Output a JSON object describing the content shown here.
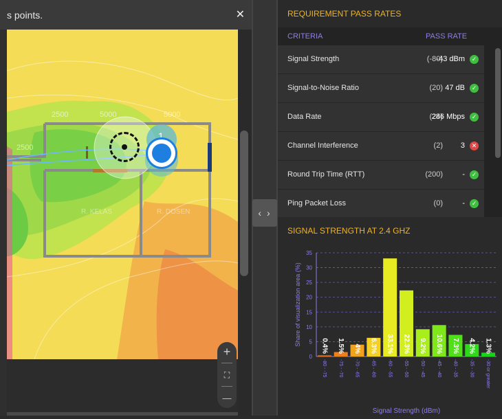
{
  "map": {
    "title": "s points.",
    "room_labels": [
      "R. KELAS",
      "R. DOSEN"
    ],
    "contour_labels": [
      "2500",
      "5000",
      "5000",
      "2500"
    ],
    "ap_badge": "1",
    "zoom_in": "+",
    "zoom_fit": "⛶",
    "zoom_out": "—"
  },
  "divider": {
    "collapse_label": "‹ ›"
  },
  "requirements": {
    "title": "REQUIREMENT PASS RATES",
    "col_criteria": "CRITERIA",
    "col_pass": "PASS RATE",
    "rows": [
      {
        "label": "Signal Strength",
        "threshold": "(-80)",
        "value": "-43 dBm",
        "status": "pass"
      },
      {
        "label": "Signal-to-Noise Ratio",
        "threshold": "(20)",
        "value": "47 dB",
        "status": "pass"
      },
      {
        "label": "Data Rate",
        "threshold": "(24)",
        "value": "286 Mbps",
        "status": "pass"
      },
      {
        "label": "Channel Interference",
        "threshold": "(2)",
        "value": "3",
        "status": "fail"
      },
      {
        "label": "Round Trip Time (RTT)",
        "threshold": "(200)",
        "value": "-",
        "status": "pass"
      },
      {
        "label": "Ping Packet Loss",
        "threshold": "(0)",
        "value": "-",
        "status": "pass"
      }
    ]
  },
  "chart_data": {
    "type": "bar",
    "title": "SIGNAL STRENGTH AT 2.4 GHZ",
    "xlabel": "Signal Strength (dBm)",
    "ylabel": "Share of visualization area (%)",
    "ylim": [
      0,
      35
    ],
    "yticks": [
      0,
      5,
      10,
      15,
      20,
      25,
      30,
      35
    ],
    "categories": [
      "-80 - -75",
      "-75 - -70",
      "-70 - -65",
      "-65 - -60",
      "-60 - -55",
      "-55 - -50",
      "-50 - -45",
      "-45 - -40",
      "-40 - -35",
      "-35 - -30",
      "-30 or greater"
    ],
    "values": [
      0.4,
      1.5,
      4,
      6.3,
      33.1,
      22.3,
      9.2,
      10.6,
      7.3,
      4.2,
      1.3
    ],
    "value_labels": [
      "0.4%",
      "1.5%",
      "4%",
      "6.3%",
      "33.1%",
      "22.3%",
      "9.2%",
      "10.6%",
      "7.3%",
      "4.2%",
      "1.3%"
    ],
    "colors": [
      "#e06a1a",
      "#ee7f1a",
      "#f0a21e",
      "#f4cf24",
      "#e8ea22",
      "#d3ee1f",
      "#a8ee1c",
      "#7fe81a",
      "#4fe018",
      "#2fd818",
      "#18d418"
    ],
    "grid": true,
    "legend": "none"
  }
}
